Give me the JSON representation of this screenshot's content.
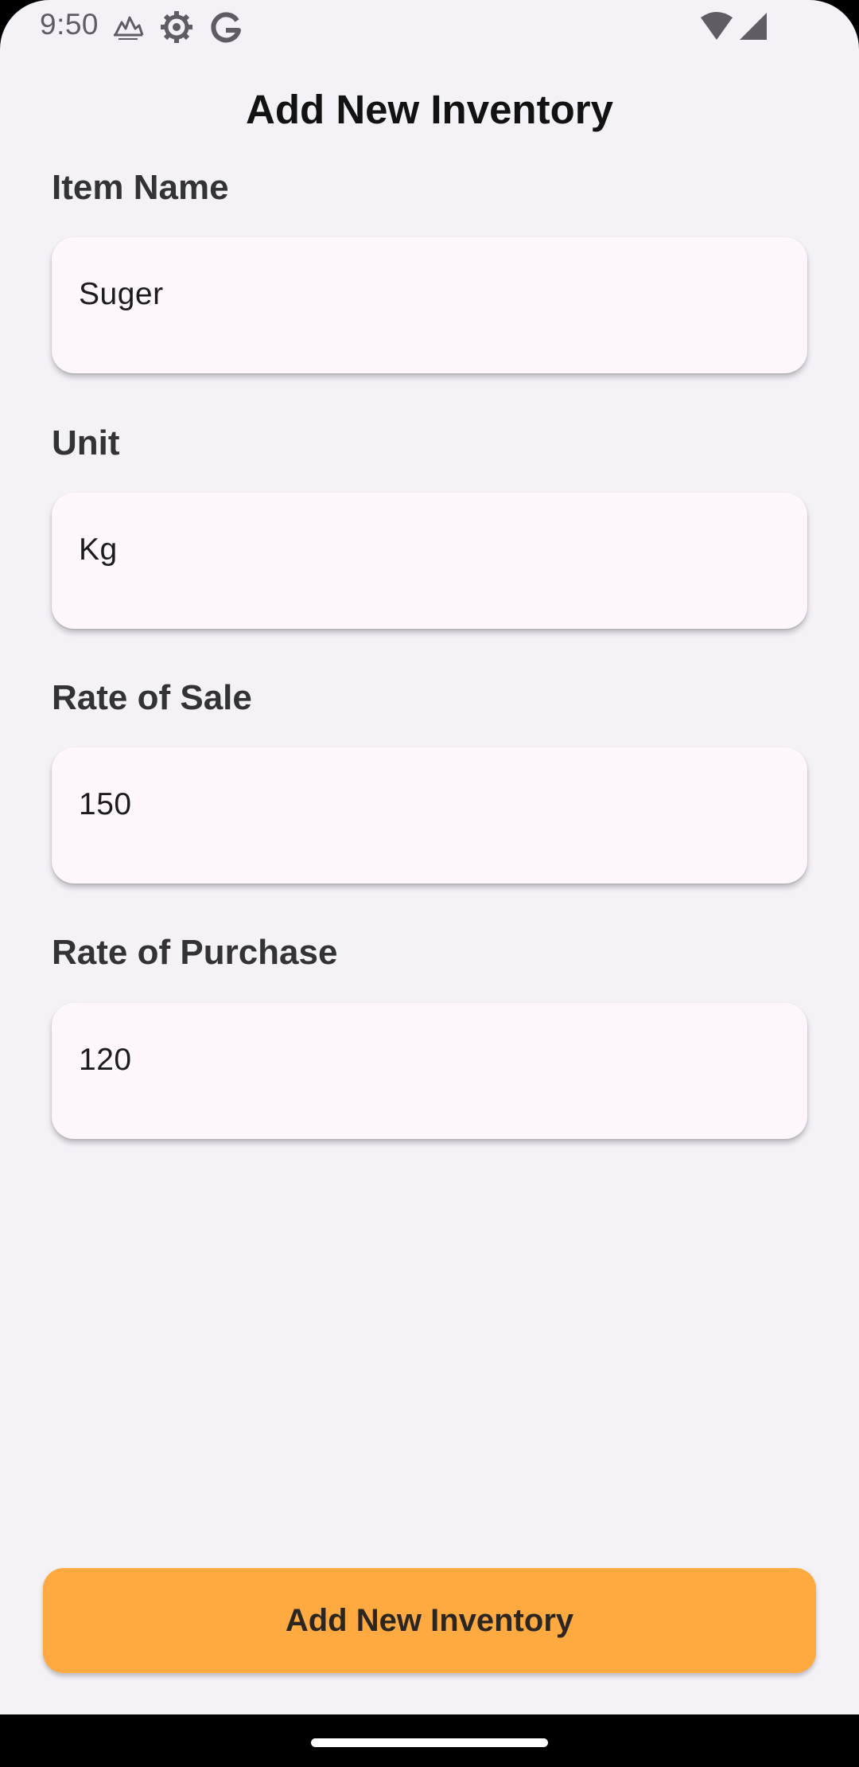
{
  "status_bar": {
    "time": "9:50",
    "icons": [
      "cloud-icon",
      "settings-gear-icon",
      "google-g-icon",
      "wifi-icon",
      "cell-signal-icon"
    ]
  },
  "header": {
    "title": "Add New Inventory"
  },
  "form": {
    "item_name": {
      "label": "Item Name",
      "value": "Suger"
    },
    "unit": {
      "label": "Unit",
      "value": "Kg"
    },
    "rate_of_sale": {
      "label": "Rate of Sale",
      "value": "150"
    },
    "rate_of_purchase": {
      "label": "Rate of Purchase",
      "value": "120"
    }
  },
  "actions": {
    "submit_label": "Add New Inventory"
  },
  "colors": {
    "background": "#f4f1f7",
    "field_background": "#fdf7fd",
    "accent": "#ffaa40",
    "nav_bar": "#000000"
  }
}
